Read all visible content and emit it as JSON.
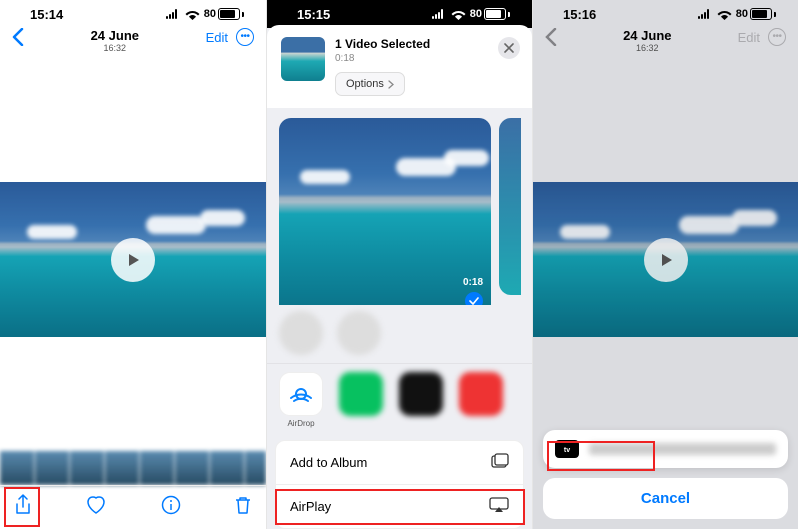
{
  "phone1": {
    "time": "15:14",
    "battery": "80",
    "title": "24 June",
    "subtitle": "16:32",
    "edit": "Edit",
    "toolbar": {
      "share": "share",
      "heart": "heart",
      "info": "info",
      "trash": "trash"
    }
  },
  "phone2": {
    "time": "15:15",
    "battery": "80",
    "selected_title": "1 Video Selected",
    "selected_sub": "0:18",
    "options": "Options",
    "preview_duration": "0:18",
    "apps": {
      "airdrop": "AirDrop"
    },
    "list": {
      "add_to_album": "Add to Album",
      "airplay": "AirPlay"
    }
  },
  "phone3": {
    "time": "15:16",
    "battery": "80",
    "title": "24 June",
    "subtitle": "16:32",
    "edit": "Edit",
    "cancel": "Cancel"
  }
}
